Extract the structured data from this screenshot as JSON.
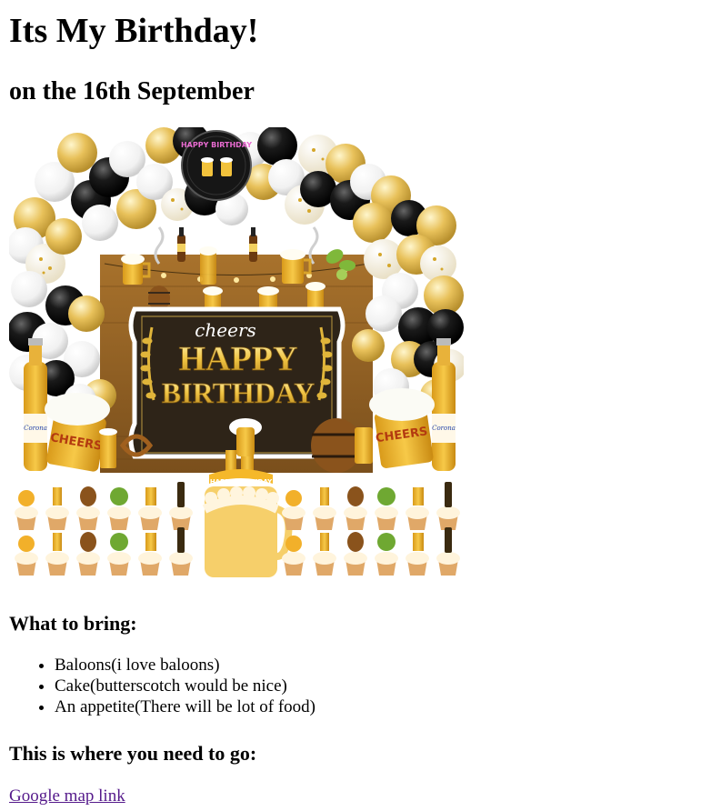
{
  "page": {
    "title": "Its My Birthday!",
    "subtitle": "on the 16th September"
  },
  "banner": {
    "script_text": "cheers",
    "line1": "HAPPY",
    "line2": "BIRTHDAY",
    "balloon_text": "HAPPY BIRTHDAY",
    "cake_topper": "HAPPY BIRTHDAY",
    "mug_text": "CHEERS",
    "bottle_text": "Corona"
  },
  "bring": {
    "heading": "What to bring:",
    "items": [
      "Baloons(i love baloons)",
      "Cake(butterscotch would be nice)",
      "An appetite(There will be lot of food)"
    ]
  },
  "directions": {
    "heading": "This is where you need to go:",
    "link_text": "Google map link"
  },
  "colors": {
    "gold": "#e8c15a",
    "black_balloon": "#111111",
    "board": "#3a2a1a",
    "link": "#551a8b"
  }
}
